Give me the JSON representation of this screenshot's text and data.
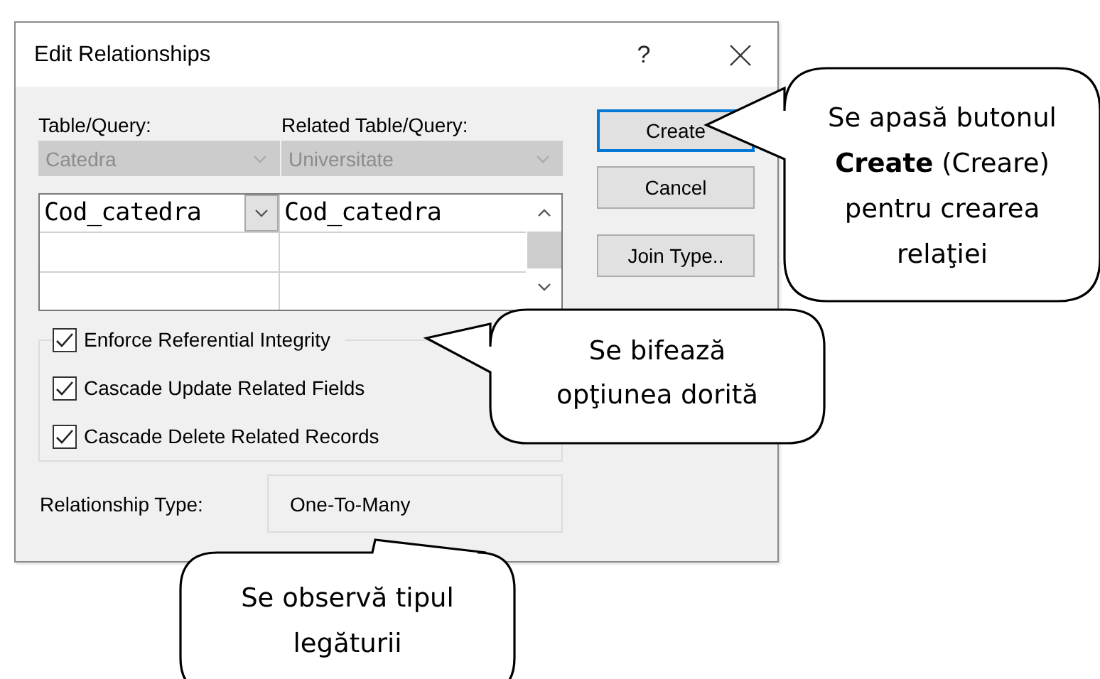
{
  "window": {
    "title": "Edit Relationships",
    "help": "?"
  },
  "table_query": {
    "label": "Table/Query:",
    "value": "Catedra",
    "disabled": true
  },
  "related_table_query": {
    "label": "Related Table/Query:",
    "value": "Universitate",
    "disabled": true
  },
  "field_grid": {
    "rows": [
      {
        "field": "Cod_catedra",
        "related_field": "Cod_catedra"
      }
    ]
  },
  "buttons": [
    {
      "label": "Create",
      "focused": true
    },
    {
      "label": "Cancel",
      "focused": false
    },
    {
      "label": "Join Type..",
      "focused": false
    }
  ],
  "options": [
    {
      "label": "Enforce Referential Integrity",
      "checked": true
    },
    {
      "label": "Cascade Update Related Fields",
      "checked": true
    },
    {
      "label": "Cascade Delete Related Records",
      "checked": true
    }
  ],
  "relationship_type": {
    "label": "Relationship Type:",
    "value": "One-To-Many"
  },
  "callouts": [
    {
      "text": "Se apasă butonul **Create** (Creare) pentru crearea relaţiei"
    },
    {
      "text": "Se bifează opţiunea dorită"
    },
    {
      "text": "Se observă tipul legăturii"
    }
  ]
}
